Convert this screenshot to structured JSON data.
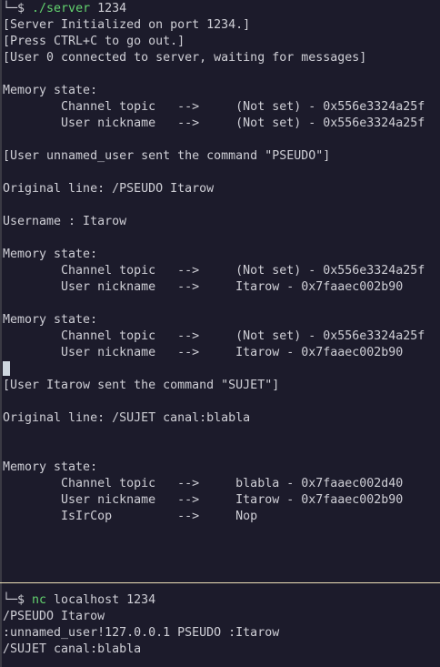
{
  "colors": {
    "background": "#1c1b2b",
    "text": "#cfcfd6",
    "command": "#63d36f",
    "divider": "#eee0b8"
  },
  "top_pane": {
    "prompt": {
      "prefix": "└─$ ",
      "command": "./server",
      "args": " 1234"
    },
    "lines": [
      "[Server Initialized on port 1234.]",
      "[Press CTRL+C to go out.]",
      "[User 0 connected to server, waiting for messages]",
      "",
      "Memory state:",
      "        Channel topic   -->     (Not set) - 0x556e3324a25f",
      "        User nickname   -->     (Not set) - 0x556e3324a25f",
      "",
      "[User unnamed_user sent the command \"PSEUDO\"]",
      "",
      "Original line: /PSEUDO Itarow",
      "",
      "Username : Itarow",
      "",
      "Memory state:",
      "        Channel topic   -->     (Not set) - 0x556e3324a25f",
      "        User nickname   -->     Itarow - 0x7faaec002b90",
      "",
      "Memory state:",
      "        Channel topic   -->     (Not set) - 0x556e3324a25f",
      "        User nickname   -->     Itarow - 0x7faaec002b90"
    ],
    "lines_after_cursor": [
      "[User Itarow sent the command \"SUJET\"]",
      "",
      "Original line: /SUJET canal:blabla",
      "",
      "",
      "Memory state:",
      "        Channel topic   -->     blabla - 0x7faaec002d40",
      "        User nickname   -->     Itarow - 0x7faaec002b90",
      "        IsIrCop         -->     Nop"
    ]
  },
  "bottom_pane": {
    "prompt": {
      "prefix": "└─$ ",
      "command": "nc",
      "args": " localhost 1234"
    },
    "lines": [
      "/PSEUDO Itarow",
      ":unnamed_user!127.0.0.1 PSEUDO :Itarow",
      "/SUJET canal:blabla"
    ]
  }
}
